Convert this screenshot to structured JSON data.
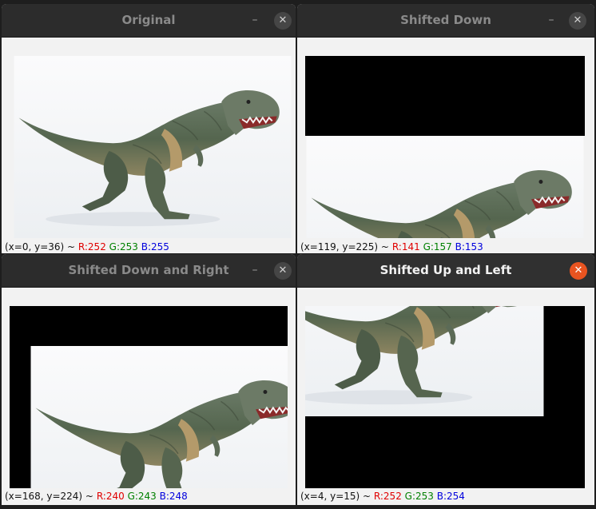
{
  "windows": [
    {
      "title": "Original",
      "active": false,
      "status": {
        "coord": "(x=0, y=36) ~",
        "r": "R:252",
        "g": "G:253",
        "b": "B:255"
      }
    },
    {
      "title": "Shifted Down",
      "active": false,
      "status": {
        "coord": "(x=119, y=225) ~",
        "r": "R:141",
        "g": "G:157",
        "b": "B:153"
      }
    },
    {
      "title": "Shifted Down and Right",
      "active": false,
      "status": {
        "coord": "(x=168, y=224) ~",
        "r": "R:240",
        "g": "G:243",
        "b": "B:248"
      }
    },
    {
      "title": "Shifted Up and Left",
      "active": true,
      "status": {
        "coord": "(x=4, y=15) ~",
        "r": "R:252",
        "g": "G:253",
        "b": "B:254"
      }
    }
  ],
  "icons": {
    "minimize": "minimize-icon",
    "close": "close-icon"
  },
  "colors": {
    "accent_close": "#e95420",
    "red": "#e00000",
    "green": "#008000",
    "blue": "#0000dd"
  }
}
